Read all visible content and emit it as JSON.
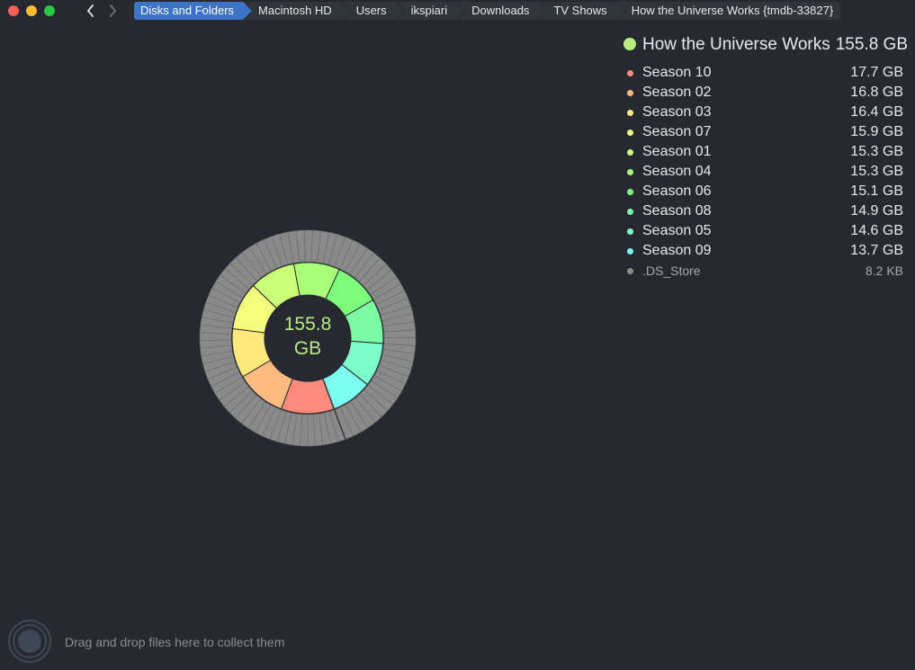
{
  "window": {
    "controls": [
      "close",
      "minimize",
      "zoom"
    ]
  },
  "navigation": {
    "back_icon": "chevron-left-icon",
    "forward_icon": "chevron-right-icon"
  },
  "breadcrumb": [
    {
      "label": "Disks and Folders",
      "active": true
    },
    {
      "label": "Macintosh HD",
      "active": false
    },
    {
      "label": "Users",
      "active": false
    },
    {
      "label": "ikspiari",
      "active": false
    },
    {
      "label": "Downloads",
      "active": false
    },
    {
      "label": "TV Shows",
      "active": false
    },
    {
      "label": "How the Universe Works {tmdb-33827}",
      "active": false
    }
  ],
  "folder": {
    "name": "How the Universe Works",
    "size": "155.8 GB",
    "color": "#b7ec83",
    "center_value": "155.8",
    "center_unit": "GB"
  },
  "items": [
    {
      "name": "Season 10",
      "size": "17.7 GB",
      "color": "#fe8a7b"
    },
    {
      "name": "Season 02",
      "size": "16.8 GB",
      "color": "#ffba80"
    },
    {
      "name": "Season 03",
      "size": "16.4 GB",
      "color": "#ffe87c"
    },
    {
      "name": "Season 07",
      "size": "15.9 GB",
      "color": "#f1ff7c"
    },
    {
      "name": "Season 01",
      "size": "15.3 GB",
      "color": "#ccff78"
    },
    {
      "name": "Season 04",
      "size": "15.3 GB",
      "color": "#a9ff78"
    },
    {
      "name": "Season 06",
      "size": "15.1 GB",
      "color": "#7dfb7b"
    },
    {
      "name": "Season 08",
      "size": "14.9 GB",
      "color": "#7dfda3"
    },
    {
      "name": "Season 05",
      "size": "14.6 GB",
      "color": "#7dfdc9"
    },
    {
      "name": "Season 09",
      "size": "13.7 GB",
      "color": "#7dfcf0"
    },
    {
      "name": ".DS_Store",
      "size": "8.2  KB",
      "color": "#8a8a8a",
      "muted": true
    }
  ],
  "footer": {
    "hint": "Drag and drop files here to collect them",
    "collector_icon": "collector-target-icon"
  },
  "chart_data": {
    "type": "pie",
    "center_label": "155.8 GB",
    "categories": [
      "Season 10",
      "Season 02",
      "Season 03",
      "Season 07",
      "Season 01",
      "Season 04",
      "Season 06",
      "Season 08",
      "Season 05",
      "Season 09",
      ".DS_Store"
    ],
    "values": [
      17.7,
      16.8,
      16.4,
      15.9,
      15.3,
      15.3,
      15.1,
      14.9,
      14.6,
      13.7,
      8.2e-06
    ],
    "unit": "GB",
    "colors": [
      "#fe8a7b",
      "#ffba80",
      "#ffe87c",
      "#f1ff7c",
      "#ccff78",
      "#a9ff78",
      "#7dfb7b",
      "#7dfda3",
      "#7dfdc9",
      "#7dfcf0",
      "#8a8a8a"
    ],
    "outer_ring_color": "#8a8a8a"
  }
}
